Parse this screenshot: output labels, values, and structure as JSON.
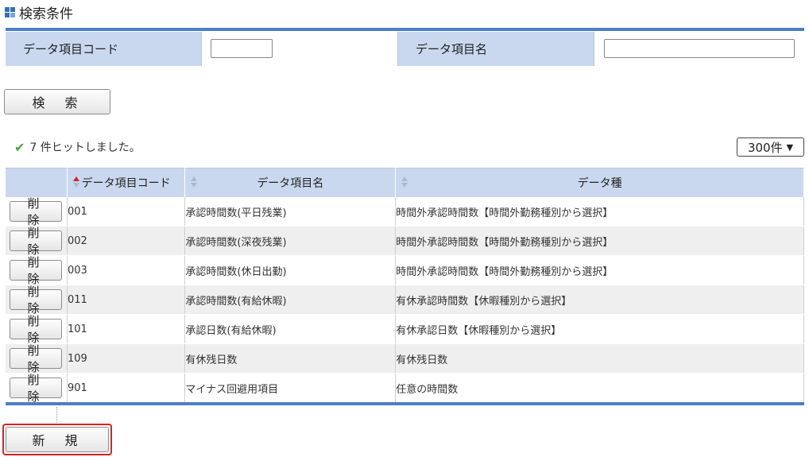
{
  "section": {
    "title": "検索条件"
  },
  "search": {
    "code_label": "データ項目コード",
    "code_value": "",
    "name_label": "データ項目名",
    "name_value": "",
    "button_label": "検 索"
  },
  "results": {
    "hit_text": "7 件ヒットしました。",
    "per_page": "300件",
    "columns": {
      "code": "データ項目コード",
      "name": "データ項目名",
      "type": "データ種"
    },
    "delete_label": "削 除",
    "rows": [
      {
        "code": "001",
        "name": "承認時間数(平日残業)",
        "type": "時間外承認時間数【時間外勤務種別から選択】"
      },
      {
        "code": "002",
        "name": "承認時間数(深夜残業)",
        "type": "時間外承認時間数【時間外勤務種別から選択】"
      },
      {
        "code": "003",
        "name": "承認時間数(休日出勤)",
        "type": "時間外承認時間数【時間外勤務種別から選択】"
      },
      {
        "code": "011",
        "name": "承認時間数(有給休暇)",
        "type": "有休承認時間数【休暇種別から選択】"
      },
      {
        "code": "101",
        "name": "承認日数(有給休暇)",
        "type": "有休承認日数【休暇種別から選択】"
      },
      {
        "code": "109",
        "name": "有休残日数",
        "type": "有休残日数"
      },
      {
        "code": "901",
        "name": "マイナス回避用項目",
        "type": "任意の時間数"
      }
    ]
  },
  "footer": {
    "new_label": "新 規"
  },
  "colors": {
    "accent": "#4a7fc6",
    "header_bg": "#c9d8ee",
    "highlight": "#e02020"
  }
}
